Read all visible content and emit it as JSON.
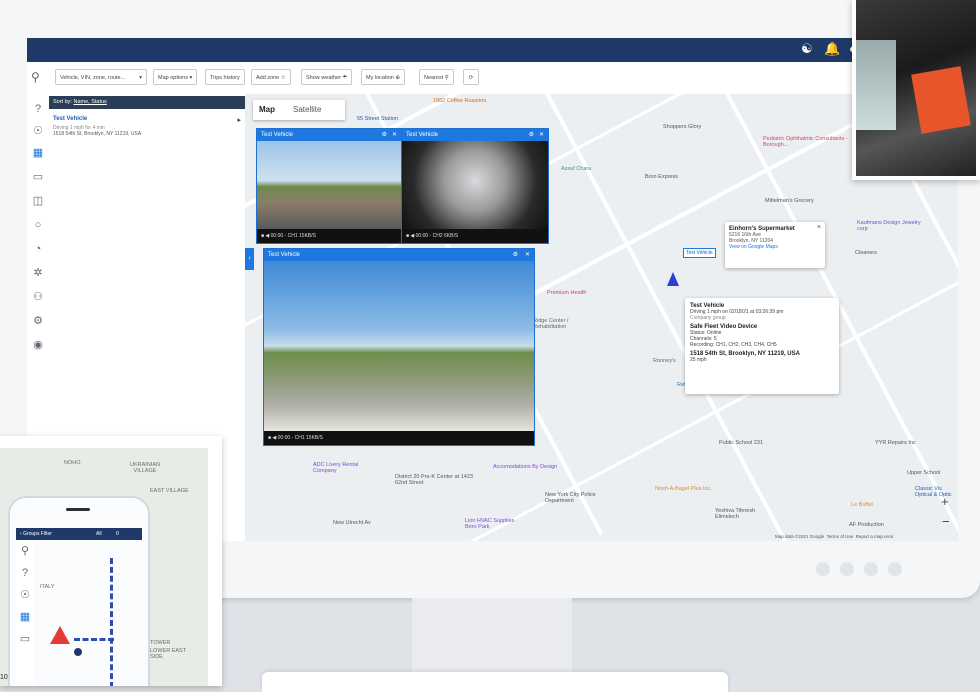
{
  "colors": {
    "navy": "#1f3a68",
    "accent": "#1d78e0",
    "alert": "#e53935"
  },
  "topbar": {
    "icons": [
      "headset-icon",
      "bell-icon",
      "user-icon"
    ]
  },
  "toolbar": {
    "search_placeholder": "Vehicle, VIN, zone, route...",
    "buttons": [
      "Map options",
      "Trips history",
      "Add zone",
      "Show weather",
      "My location",
      "Nearest"
    ],
    "refresh_icon": "refresh-icon"
  },
  "rail": {
    "icons": [
      "search-icon",
      "help-icon",
      "fingerprint-icon",
      "map-icon",
      "truck-icon",
      "camera-icon",
      "circle-icon",
      "gauge-icon",
      "gear-alt-icon",
      "hierarchy-icon",
      "settings-icon",
      "pin-icon"
    ]
  },
  "list": {
    "sort_label": "Sort by:",
    "sort_value": "Name, Status",
    "vehicle": {
      "name": "Test Vehicle",
      "status": "Driving 1 mph for 4 min",
      "address": "1518 54th St, Brooklyn, NY 11219, USA"
    }
  },
  "map": {
    "tabs": [
      "Map",
      "Satellite"
    ],
    "labels": [
      "55 Street Station",
      "1882 Coffee Roasters",
      "Shoppers Glory",
      "Pediatric Ophthalmic Consultants - Borough...",
      "Assaf Chara",
      "Boro Express",
      "Mittelman's Grocery",
      "Kaufmans Design Jewelry corp",
      "Cleaners",
      "Premium Health",
      "Ridge Center / Rehabilitation",
      "Rooney's",
      "Refresh Pharm",
      "Public School 231",
      "YYR Repairs Inc",
      "Upper School",
      "Accomodations By Design",
      "Nosh-A-Bagel Plus Inc.",
      "New York City Police Department",
      "Yeshiva Tiferesh Elimelech",
      "Le Buffet",
      "AF Production",
      "District 20 Pre-K Center at 1423 62nd Street",
      "Lion HVAC Supplies Boro Park",
      "New Utrecht Av",
      "ADC Livery Rental Company",
      "Classic Vis Optical & Optic",
      "Map data ©2021 Google",
      "Terms of Use",
      "Report a map error"
    ],
    "vehicle_tag": "Test Vehicle",
    "zoom_in": "+",
    "zoom_out": "−",
    "store_popup": {
      "name": "Einhorn's Supermarket",
      "line1": "5216 16th Ave",
      "line2": "Brooklyn, NY 11204",
      "link": "View on Google Maps",
      "close": "×"
    },
    "info_popup": {
      "vehicle": "Test Vehicle",
      "vehicle_line": "Driving 1 mph on 02/18/21 at 03:26:39 pm",
      "vehicle_group": "Company group",
      "device": "Safe Fleet Video Device",
      "device_status": "Status: Online",
      "device_channels": "Channels: 5",
      "device_recording": "Recording: CH1, CH2, CH3, CH4, CH5",
      "address": "1518 54th St, Brooklyn, NY 11219, USA",
      "speed": "25 mph"
    }
  },
  "videos": [
    {
      "title": "Test Vehicle",
      "footer": "00:00 - CH1 15KB/S"
    },
    {
      "title": "Test Vehicle",
      "footer": "00:00 - CH2 6KB/S"
    },
    {
      "title": "Test Vehicle",
      "footer": "00:00 - CH1 15KB/S"
    }
  ],
  "tablet": {
    "map_labels": [
      "NOHO",
      "UKRAINIAN VILLAGE",
      "EAST VILLAGE",
      "ITALY",
      "LOWER EAST SIDE",
      "TOWER"
    ],
    "phone": {
      "group": "Groups Filter",
      "filter": "All",
      "count": "0"
    },
    "bottom_label": "10"
  }
}
